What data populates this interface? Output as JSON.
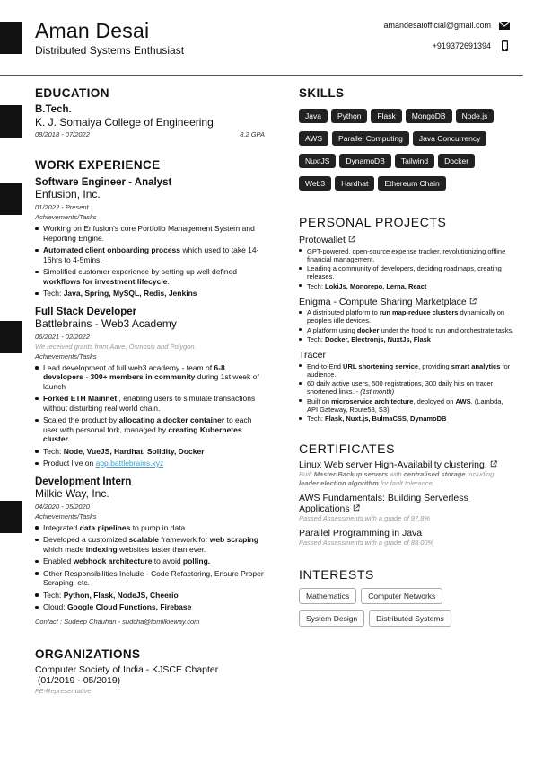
{
  "header": {
    "name": "Aman Desai",
    "tagline": "Distributed Systems Enthusiast",
    "email": "amandesaiofficial@gmail.com",
    "phone": "+919372691394",
    "email_icon": "envelope-icon",
    "phone_icon": "mobile-phone-icon"
  },
  "education": {
    "title": "EDUCATION",
    "degree": "B.Tech.",
    "school": "K. J. Somaiya College of Engineering",
    "dates": "08/2018 - 07/2022",
    "gpa": "8.2 GPA"
  },
  "work": {
    "title": "WORK EXPERIENCE",
    "jobs": [
      {
        "role": "Software Engineer - Analyst",
        "company": "Enfusion, Inc.",
        "dates": "01/2022 - Present",
        "sub": "Achievements/Tasks",
        "b0": "Working on Enfusion's core Portfolio Management System and Reporting Engine.",
        "b1a": "Automated client onboarding process",
        "b1b": " which used to take 14-16hrs to 4-5mins.",
        "b2a": "Simplified customer experience by setting up well defined ",
        "b2b": "workflows for investment lifecycle",
        "b2c": ".",
        "b3a": "Tech: ",
        "b3b": "Java, Spring, MySQL, Redis, Jenkins"
      },
      {
        "role": "Full Stack Developer",
        "company": "Battlebrains - Web3 Academy",
        "dates": "06/2021 - 02/2022",
        "note": "We received grants from Aave, Osmosis and Polygon.",
        "sub": "Achievements/Tasks",
        "b0a": "Lead development of full web3 academy - team of ",
        "b0b": "6-8 developers",
        "b0c": " - ",
        "b0d": "300+ members in community",
        "b0e": " during 1st week of launch",
        "b1a": "Forked ETH Mainnet",
        "b1b": " , enabling users to simulate transactions without disturbing real world chain.",
        "b2a": "Scaled the product by ",
        "b2b": "allocating a docker container",
        "b2c": " to each user with personal fork, managed by ",
        "b2d": "creating Kubernetes cluster",
        "b2e": " .",
        "b3a": "Tech: ",
        "b3b": "Node, VueJS, Hardhat, Solidity, Docker",
        "b4a": "Product live on ",
        "b4b": "app.battlebrains.xyz"
      },
      {
        "role": "Development Intern",
        "company": "Milkie Way, Inc.",
        "dates": "04/2020 - 05/2020",
        "sub": "Achievements/Tasks",
        "b0a": "Integrated ",
        "b0b": "data pipelines",
        "b0c": " to pump in data.",
        "b1a": "Developed a customized ",
        "b1b": "scalable",
        "b1c": " framework for ",
        "b1d": "web scraping",
        "b1e": " which made ",
        "b1f": "indexing",
        "b1g": " websites faster than ever.",
        "b2a": "Enabled ",
        "b2b": "webhook architecture",
        "b2c": " to avoid ",
        "b2d": "polling.",
        "b3": "Other Responsibilities Include - Code Refactoring, Ensure Proper Scraping, etc.",
        "b4a": "Tech: ",
        "b4b": "Python, Flask, NodeJS, Cheerio",
        "b5a": "Cloud: ",
        "b5b": "Google Cloud Functions, Firebase",
        "contact": "Contact : Sudeep Chauhan  -  sudcha@tomilkieway.com"
      }
    ]
  },
  "organizations": {
    "title": "ORGANIZATIONS",
    "name": "Computer Society of India - KJSCE Chapter",
    "dates": " (01/2019 - 05/2019)",
    "role": "FE-Representative"
  },
  "skills": {
    "title": "SKILLS",
    "items": [
      "Java",
      "Python",
      "Flask",
      "MongoDB",
      "Node.js",
      "AWS",
      "Parallel Computing",
      "Java Concurrency",
      "NuxtJS",
      "DynamoDB",
      "Tailwind",
      "Docker",
      "Web3",
      "Hardhat",
      "Ethereum Chain"
    ]
  },
  "projects": {
    "title": "PERSONAL PROJECTS",
    "link_icon": "external-link-icon",
    "items": [
      {
        "name": "Protowallet",
        "b0": "GPT-powered, open-source expense tracker, revolutionizing offline financial management.",
        "b1": "Leading a community of developers, deciding roadmaps, creating releases.",
        "b2a": "Tech: ",
        "b2b": "LokiJs, Monorepo, Lerna, React"
      },
      {
        "name": "Enigma - Compute Sharing Marketplace",
        "b0a": "A distributed platform to ",
        "b0b": "run map-reduce clusters",
        "b0c": " dynamically on people's idle devices.",
        "b1a": "A platform using ",
        "b1b": "docker",
        "b1c": " under the hood to run and orchestrate tasks.",
        "b2a": "Tech: ",
        "b2b": "Docker, Electronjs, NuxtJs, Flask"
      },
      {
        "name": "Tracer",
        "b0a": "End-to-End ",
        "b0b": "URL shortening service",
        "b0c": ", providing ",
        "b0d": "smart analytics",
        "b0e": " for audience.",
        "b1a": "60 daily active users, 500 registrations, 300 daily hits on tracer shortened links. - ",
        "b1b": "(1st month)",
        "b2a": "Built on ",
        "b2b": "microservice architecture",
        "b2c": ", deployed on ",
        "b2d": "AWS",
        "b2e": ". (Lambda, API Gateway, Route53, S3)",
        "b3a": "Tech: ",
        "b3b": "Flask, Nuxt.js, BulmaCSS, DynamoDB"
      }
    ]
  },
  "certificates": {
    "title": "CERTIFICATES",
    "items": [
      {
        "name": "Linux Web server High-Availability clustering.",
        "d0": "Built ",
        "d1": "Master-Backup servers",
        "d2": " with ",
        "d3": "centralised storage",
        "d4": " including ",
        "d5": "leader election algorithm",
        "d6": " for fault tolerance."
      },
      {
        "name": "AWS Fundamentals: Building Serverless Applications",
        "desc": "Passed Assessments with a grade of 97.8%"
      },
      {
        "name": "Parallel Programming in Java",
        "desc": "Passed Assessments with a grade of 88.00%"
      }
    ]
  },
  "interests": {
    "title": "INTERESTS",
    "items": [
      "Mathematics",
      "Computer Networks",
      "System Design",
      "Distributed Systems"
    ]
  }
}
